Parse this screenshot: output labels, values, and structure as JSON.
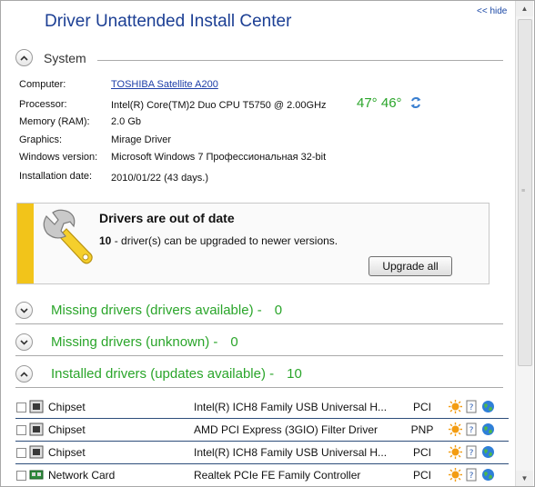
{
  "header": {
    "title": "Driver Unattended Install Center",
    "hide_link": "<< hide"
  },
  "system": {
    "section_label": "System",
    "rows": [
      {
        "label": "Computer:",
        "value": "TOSHIBA Satellite A200",
        "is_link": true
      },
      {
        "label": "Processor:",
        "value": "Intel(R) Core(TM)2 Duo CPU T5750 @ 2.00GHz"
      },
      {
        "label": "Memory (RAM):",
        "value": "2.0 Gb"
      },
      {
        "label": "Graphics:",
        "value": "Mirage Driver"
      },
      {
        "label": "Windows version:",
        "value": "Microsoft Windows 7 Профессиональная 32-bit"
      },
      {
        "label": "Installation date:",
        "value": "2010/01/22 (43 days.)"
      }
    ],
    "cpu_temps": "47° 46°"
  },
  "alert": {
    "title": "Drivers are out of date",
    "count": "10",
    "message": " - driver(s) can be upgraded to newer versions.",
    "button": "Upgrade all"
  },
  "sections": [
    {
      "label": "Missing drivers (drivers available) -",
      "count": "0"
    },
    {
      "label": "Missing drivers (unknown) -",
      "count": "0"
    },
    {
      "label": "Installed drivers (updates available) -",
      "count": "10"
    }
  ],
  "drivers": [
    {
      "category": "Chipset",
      "icon": "chip-icon",
      "description": "Intel(R) ICH8 Family USB Universal H...",
      "bus": "PCI"
    },
    {
      "category": "Chipset",
      "icon": "chip-icon",
      "description": "AMD PCI Express (3GIO) Filter Driver",
      "bus": "PNP"
    },
    {
      "category": "Chipset",
      "icon": "chip-icon",
      "description": "Intel(R) ICH8 Family USB Universal H...",
      "bus": "PCI"
    },
    {
      "category": "Network Card",
      "icon": "network-card-icon",
      "description": "Realtek PCIe FE Family Controller",
      "bus": "PCI"
    }
  ],
  "colors": {
    "title": "#1c3f94",
    "green": "#2aa52a",
    "alert_bar": "#f2c41a"
  }
}
